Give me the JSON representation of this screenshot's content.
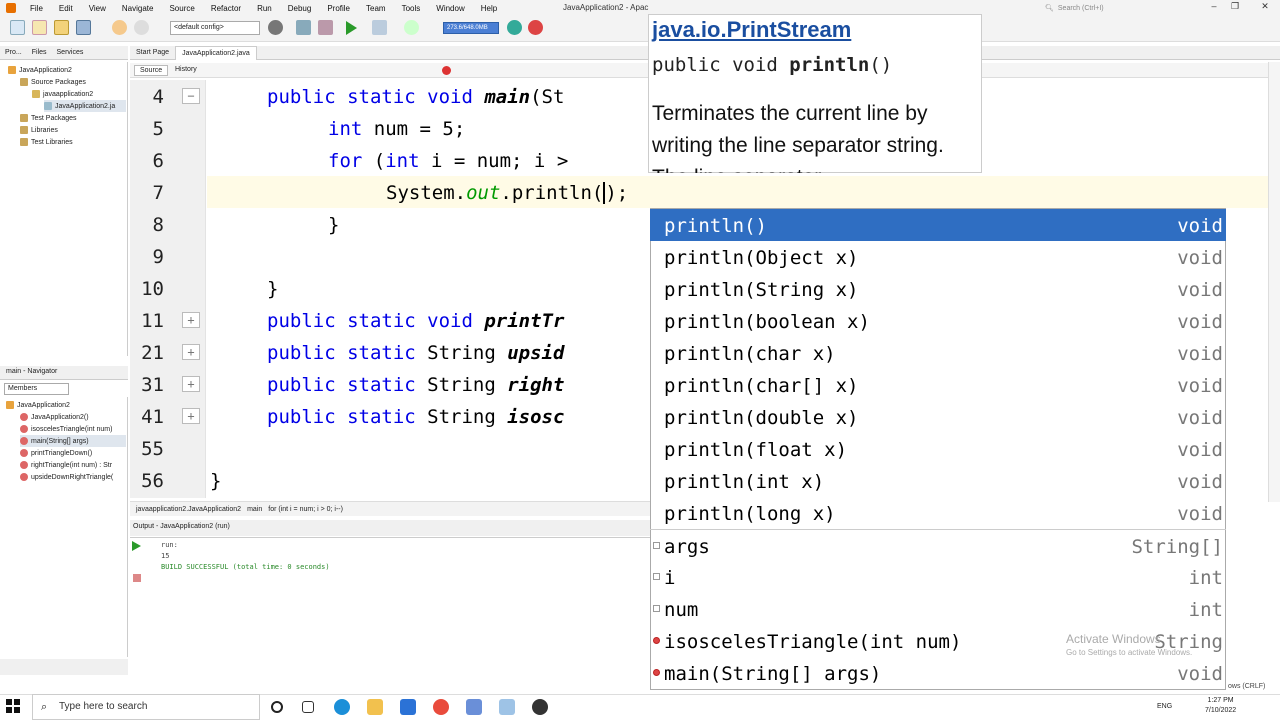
{
  "menu": {
    "items": [
      "File",
      "Edit",
      "View",
      "Navigate",
      "Source",
      "Refactor",
      "Run",
      "Debug",
      "Profile",
      "Team",
      "Tools",
      "Window",
      "Help"
    ],
    "title": "JavaApplication2 - Apac",
    "search_placeholder": "Search (Ctrl+I)"
  },
  "toolbar": {
    "config": "<default config>",
    "memory": "273.6/648.0MB"
  },
  "left_panel": {
    "tabs": [
      "Pro...",
      "Files",
      "Services"
    ],
    "tree": [
      "JavaApplication2",
      "Source Packages",
      "javaapplication2",
      "JavaApplication2.ja",
      "Test Packages",
      "Libraries",
      "Test Libraries"
    ],
    "navigator_title": "main - Navigator",
    "members_select": "Members",
    "navigator_items": [
      "JavaApplication2",
      "JavaApplication2()",
      "isoscelesTriangle(int num)",
      "main(String[] args)",
      "printTriangleDown()",
      "rightTriangle(int num) : Str",
      "upsideDownRightTriangle("
    ]
  },
  "editor": {
    "tabs": [
      "Start Page",
      "JavaApplication2.java"
    ],
    "source_tab": "Source",
    "history_tab": "History",
    "line_numbers": [
      "4",
      "5",
      "6",
      "7",
      "8",
      "9",
      "10",
      "11",
      "21",
      "31",
      "41",
      "55",
      "56"
    ],
    "breadcrumbs": [
      "javaapplication2.JavaApplication2",
      "main",
      "for (int i = num; i > 0; i--)"
    ]
  },
  "output": {
    "tab": "Output - JavaApplication2 (run)",
    "lines": [
      "run:",
      "15",
      "BUILD SUCCESSFUL (total time: 0 seconds)"
    ]
  },
  "javadoc": {
    "class_name": "java.io.PrintStream",
    "signature_prefix": "public void ",
    "signature_method": "println",
    "signature_suffix": "()",
    "description": "Terminates the current line by writing the line separator string. The line separator"
  },
  "completion": {
    "items": [
      {
        "name": "println()",
        "type": "void"
      },
      {
        "name": "println(Object x)",
        "type": "void"
      },
      {
        "name": "println(String x)",
        "type": "void"
      },
      {
        "name": "println(boolean x)",
        "type": "void"
      },
      {
        "name": "println(char x)",
        "type": "void"
      },
      {
        "name": "println(char[] x)",
        "type": "void"
      },
      {
        "name": "println(double x)",
        "type": "void"
      },
      {
        "name": "println(float x)",
        "type": "void"
      },
      {
        "name": "println(int x)",
        "type": "void"
      },
      {
        "name": "println(long x)",
        "type": "void"
      },
      {
        "name": "args",
        "type": "String[]"
      },
      {
        "name": "i",
        "type": "int"
      },
      {
        "name": "num",
        "type": "int"
      },
      {
        "name": "isoscelesTriangle(int num)",
        "type": "String"
      },
      {
        "name": "main(String[] args)",
        "type": "void"
      }
    ]
  },
  "watermark": {
    "line1": "Activate Windows",
    "line2": "Go to Settings to activate Windows."
  },
  "taskbar": {
    "search_placeholder": "Type here to search",
    "time": "1:27 PM",
    "date": "7/10/2022",
    "lang": "ENG"
  },
  "status_right": "ows (CRLF)"
}
